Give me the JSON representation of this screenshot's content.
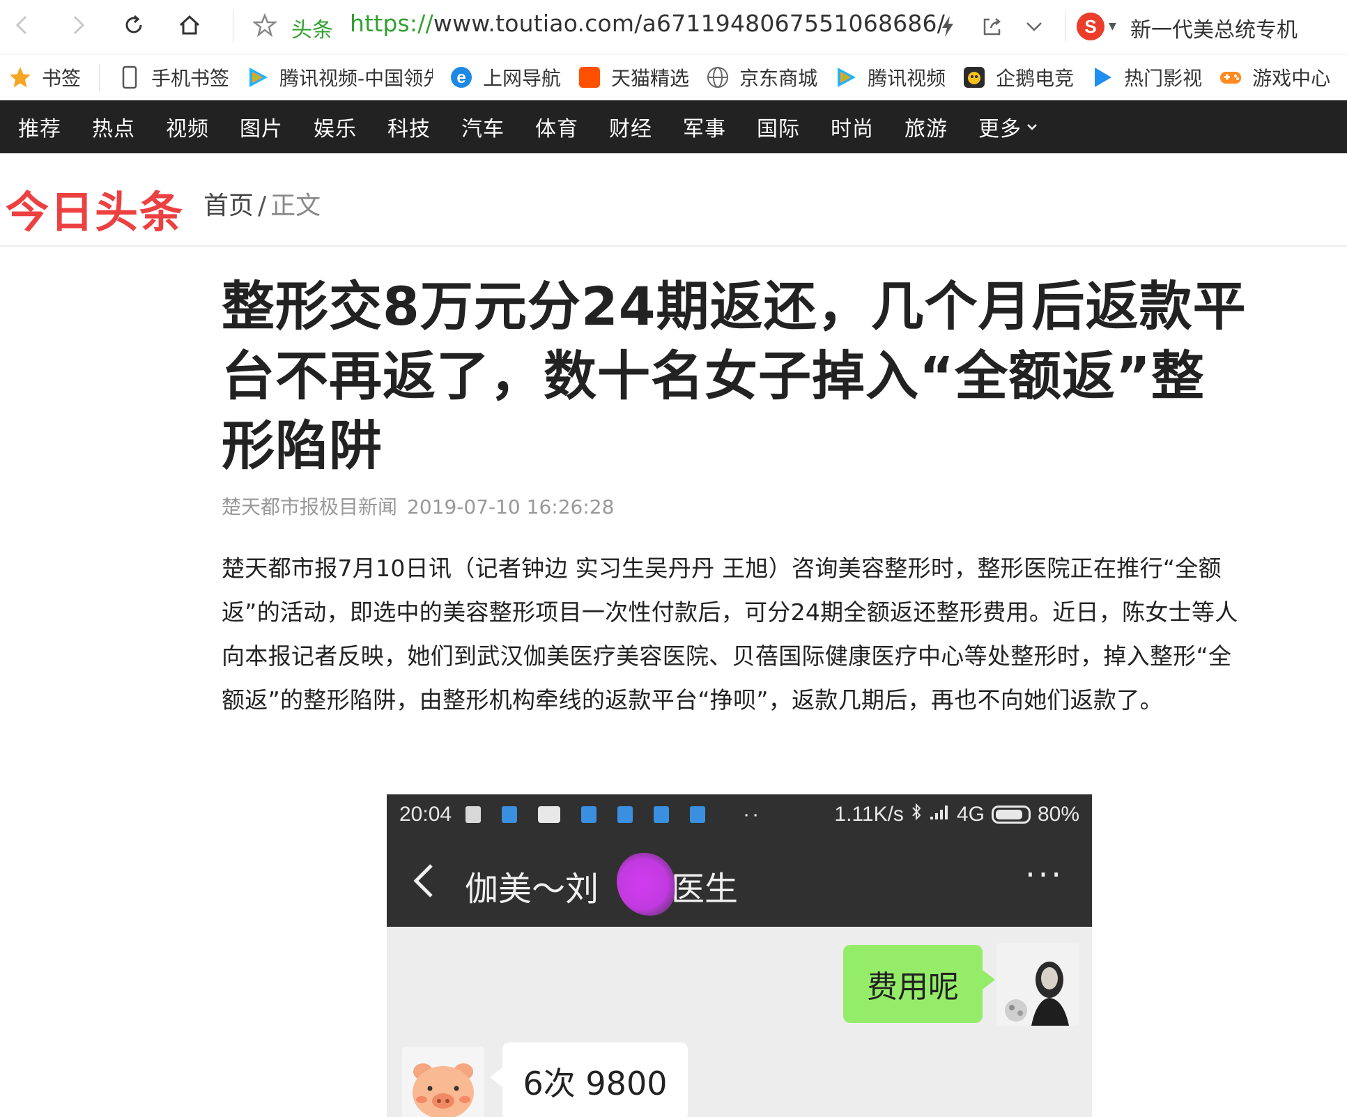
{
  "browser": {
    "site_tag": "头条",
    "url_protocol": "https://",
    "url_rest": "www.toutiao.com/a6711948067551068686/",
    "search_text": "新一代美总统专机"
  },
  "bookmarks": [
    {
      "label": "书签",
      "icon": "star-icon"
    },
    {
      "label": "手机书签",
      "icon": "phone-icon"
    },
    {
      "label": "腾讯视频-中国领先",
      "icon": "tencent-video-icon"
    },
    {
      "label": "上网导航",
      "icon": "ie-icon"
    },
    {
      "label": "天猫精选",
      "icon": "taobao-icon"
    },
    {
      "label": "京东商城",
      "icon": "globe-icon"
    },
    {
      "label": "腾讯视频",
      "icon": "tencent-video-icon"
    },
    {
      "label": "企鹅电竞",
      "icon": "penguin-icon"
    },
    {
      "label": "热门影视",
      "icon": "play-icon"
    },
    {
      "label": "游戏中心",
      "icon": "gamepad-icon"
    }
  ],
  "nav": {
    "items": [
      "推荐",
      "热点",
      "视频",
      "图片",
      "娱乐",
      "科技",
      "汽车",
      "体育",
      "财经",
      "军事",
      "国际",
      "时尚",
      "旅游"
    ],
    "more": "更多"
  },
  "header": {
    "logo": "今日头条",
    "crumb_home": "首页",
    "crumb_sep": "/",
    "crumb_current": "正文"
  },
  "article": {
    "title": "整形交8万元分24期返还，几个月后返款平台不再返了，数十名女子掉入“全额返”整形陷阱",
    "source": "楚天都市报极目新闻",
    "datetime": "2019-07-10 16:26:28",
    "lead": "楚天都市报7月10日讯（记者钟边 实习生吴丹丹 王旭）咨询美容整形时，整形医院正在推行“全额返”的活动，即选中的美容整形项目一次性付款后，可分24期全额返还整形费用。近日，陈女士等人向本报记者反映，她们到武汉伽美医疗美容医院、贝蓓国际健康医疗中心等处整形时，掉入整形“全额返”的整形陷阱，由整形机构牵线的返款平台“挣呗”，返款几期后，再也不向她们返款了。"
  },
  "screenshot": {
    "time": "20:04",
    "dots": "··",
    "speed": "1.11K/s",
    "network": "4G",
    "battery": "80%",
    "chat_title_left": "伽美～刘",
    "chat_title_right": "医生",
    "msg_me": "费用呢",
    "msg_other": "6次 9800"
  },
  "colors": {
    "logo_red": "#ed4040",
    "nav_bg": "#222222",
    "url_green": "#31a12f",
    "wechat_bubble": "#95ec69"
  }
}
